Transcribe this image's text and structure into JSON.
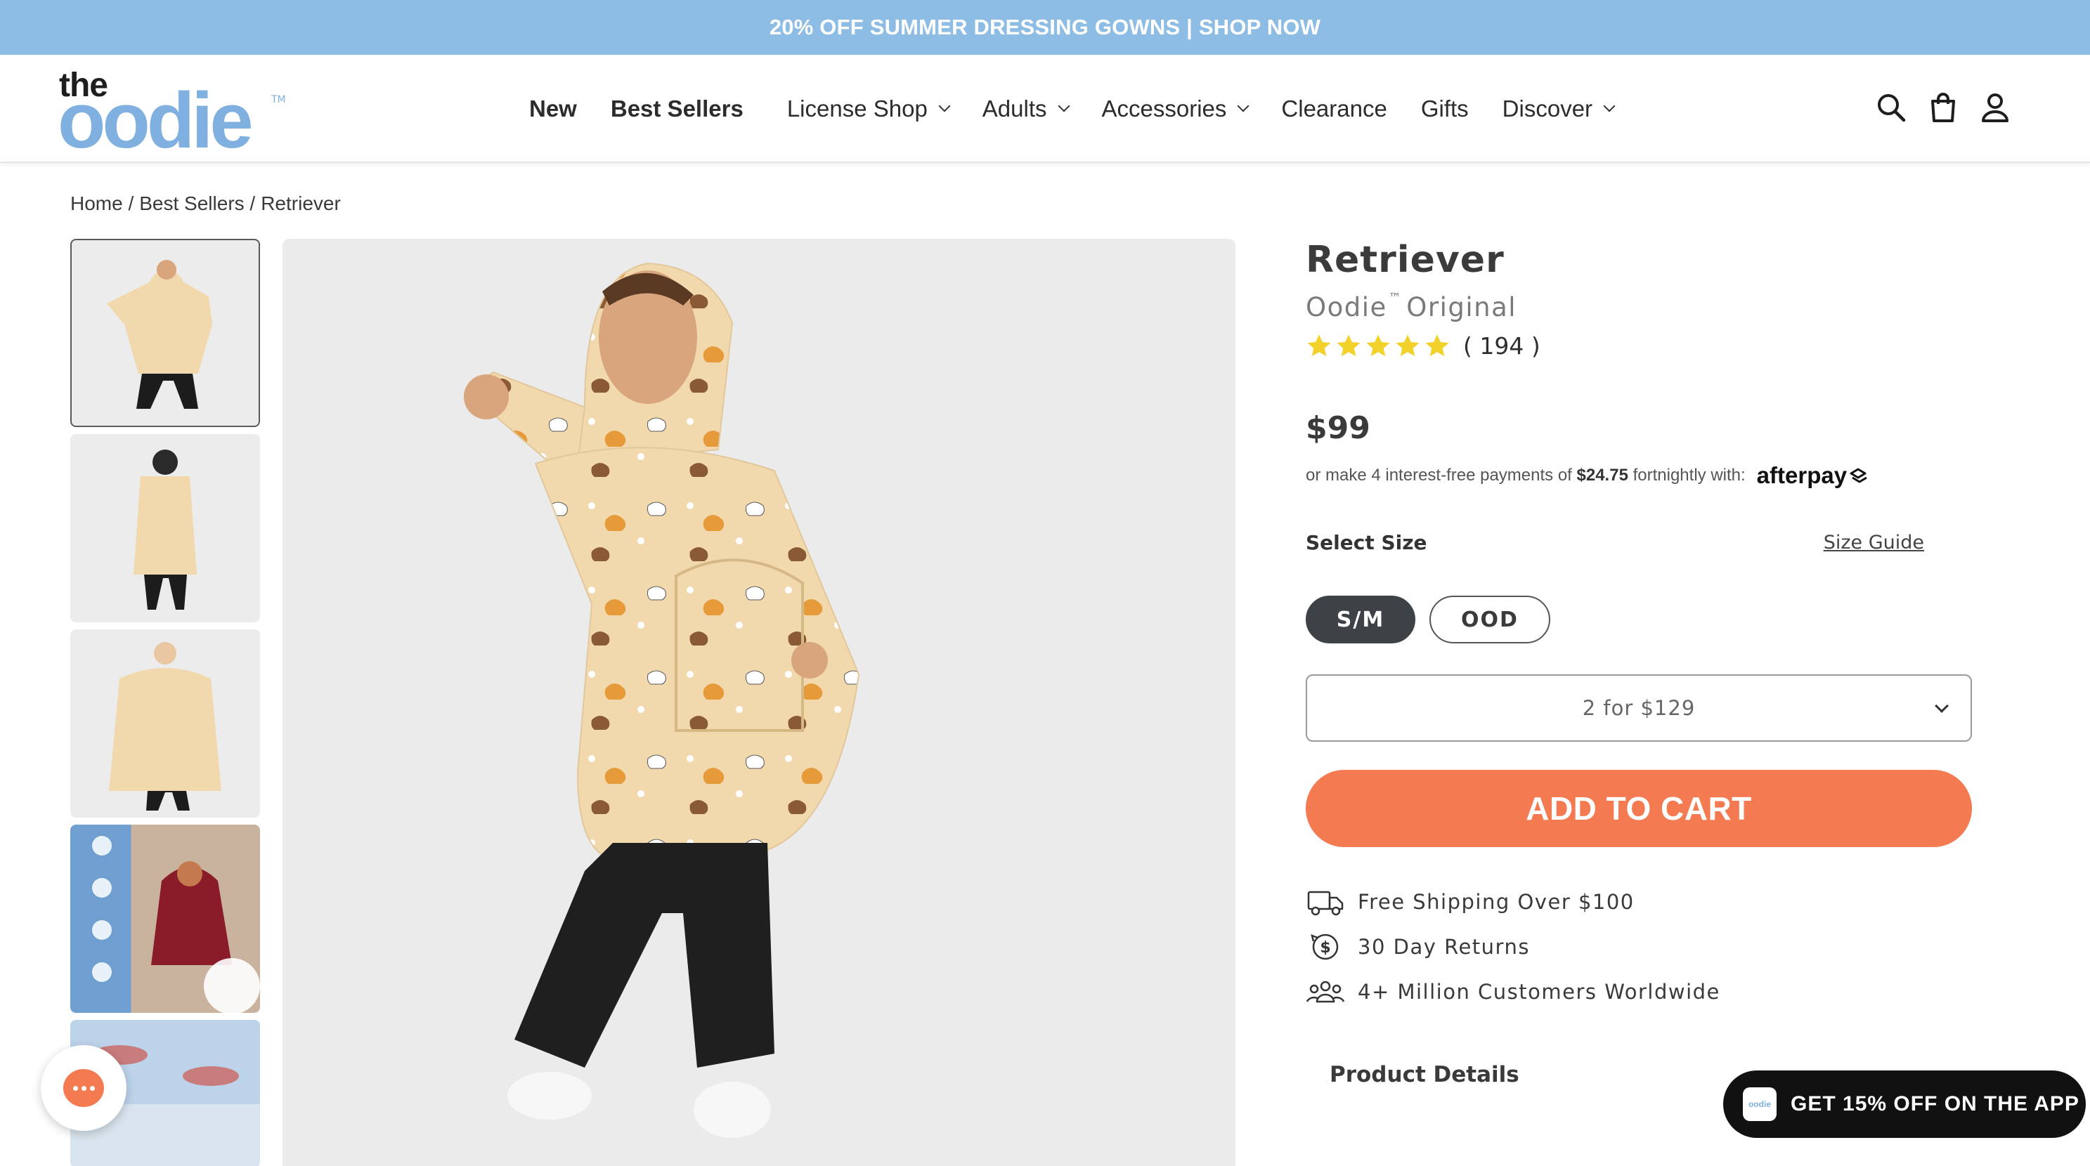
{
  "announcement": {
    "text": "20% OFF SUMMER DRESSING GOWNS | SHOP NOW"
  },
  "header": {
    "logo": {
      "top": "the",
      "main": "oodie",
      "tm": "TM"
    },
    "nav": [
      {
        "label": "New",
        "bold": true,
        "dropdown": false
      },
      {
        "label": "Best Sellers",
        "bold": true,
        "dropdown": false
      },
      {
        "label": "License Shop",
        "bold": false,
        "dropdown": true
      },
      {
        "label": "Adults",
        "bold": false,
        "dropdown": true
      },
      {
        "label": "Accessories",
        "bold": false,
        "dropdown": true
      },
      {
        "label": "Clearance",
        "bold": false,
        "dropdown": false
      },
      {
        "label": "Gifts",
        "bold": false,
        "dropdown": false
      },
      {
        "label": "Discover",
        "bold": false,
        "dropdown": true
      }
    ],
    "icons": [
      "search-icon",
      "cart-icon",
      "account-icon"
    ]
  },
  "breadcrumb": {
    "home": "Home /",
    "category": "Best Sellers /",
    "current": "Retriever"
  },
  "gallery": {
    "thumbnails": [
      "thumbnail-1",
      "thumbnail-2",
      "thumbnail-3",
      "thumbnail-4",
      "thumbnail-5"
    ],
    "active_index": 0
  },
  "product": {
    "title": "Retriever",
    "subtitle": "Oodie",
    "subtitle_tm": "™",
    "subtitle_rest": "Original",
    "rating_stars": 5,
    "review_count": "( 194 )",
    "price": "$99",
    "afterpay": {
      "prefix": "or make 4 interest-free payments of",
      "amount": "$24.75",
      "suffix": "fortnightly with:",
      "brand": "afterpay"
    },
    "size_label": "Select Size",
    "size_guide": "Size Guide",
    "sizes": [
      {
        "label": "S/M",
        "selected": true
      },
      {
        "label": "OOD",
        "selected": false
      }
    ],
    "bundle_selected": "2 for $129",
    "add_to_cart": "ADD TO CART",
    "perks": [
      {
        "icon": "truck-icon",
        "text": "Free Shipping Over $100"
      },
      {
        "icon": "returns-icon",
        "text": "30 Day Returns"
      },
      {
        "icon": "customers-icon",
        "text": "4+ Million Customers Worldwide"
      }
    ],
    "details_heading": "Product Details"
  },
  "app_promo": {
    "icon_text": "oodie",
    "text": "GET 15% OFF ON THE APP"
  },
  "colors": {
    "announcement_bg": "#8dbde4",
    "logo_blue": "#7fb0df",
    "cta": "#f47a52",
    "selected_size": "#3d4246",
    "star": "#f2d22a"
  }
}
